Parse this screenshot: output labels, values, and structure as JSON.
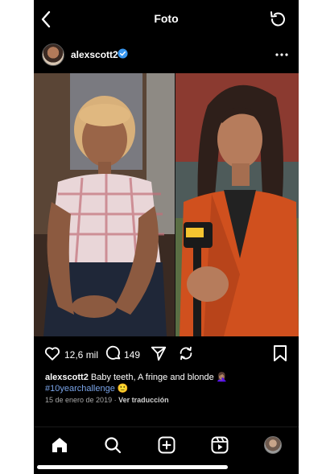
{
  "header": {
    "title": "Foto"
  },
  "post": {
    "username": "alexscott2",
    "likes": "12,6 mil",
    "comments": "149",
    "caption_user": "alexscott2",
    "caption_text": "Baby teeth, A fringe and blonde 🤦🏽‍♀️",
    "hashtag": "#10yearchallenge",
    "hashtag_emoji": "🙂",
    "date": "15 de enero de 2019",
    "separator": "·",
    "translate_label": "Ver traducción"
  },
  "icons": {
    "back": "chevron-left-icon",
    "refresh": "refresh-icon",
    "verified": "verified-badge-icon",
    "more": "more-horizontal-icon",
    "like": "heart-icon",
    "comment": "comment-icon",
    "share": "send-icon",
    "repost": "repost-icon",
    "save": "bookmark-icon",
    "home": "home-icon",
    "search": "search-icon",
    "create": "plus-square-icon",
    "reels": "reels-icon",
    "profile": "profile-avatar"
  },
  "colors": {
    "background": "#000000",
    "text": "#ffffff",
    "hashtag": "#7aa4e8",
    "verified": "#3897f0",
    "muted": "#a8a8a8"
  }
}
